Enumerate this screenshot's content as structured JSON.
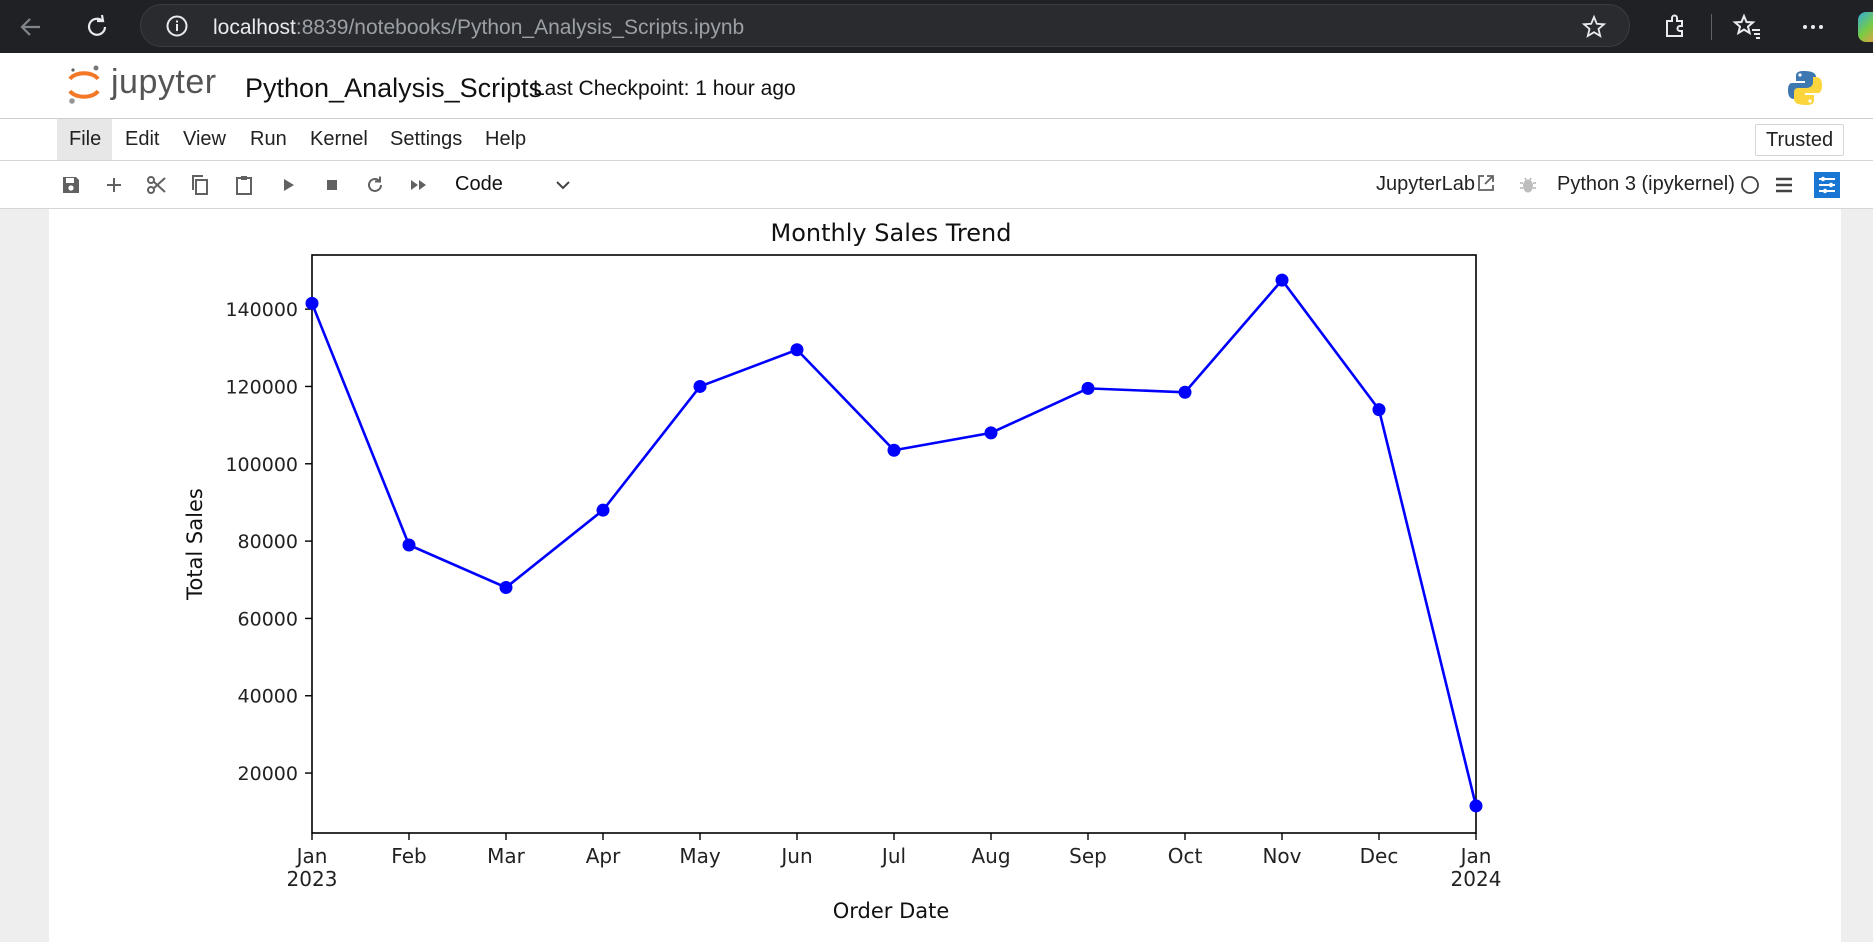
{
  "browser": {
    "url_host": "localhost",
    "url_rest": ":8839/notebooks/Python_Analysis_Scripts.ipynb"
  },
  "header": {
    "logo_text": "jupyter",
    "notebook_name": "Python_Analysis_Scripts",
    "checkpoint": "Last Checkpoint: 1 hour ago"
  },
  "menu": {
    "items": [
      "File",
      "Edit",
      "View",
      "Run",
      "Kernel",
      "Settings",
      "Help"
    ],
    "trusted": "Trusted"
  },
  "toolbar": {
    "cell_type": "Code",
    "jupyterlab": "JupyterLab",
    "kernel": "Python 3 (ipykernel)"
  },
  "colors": {
    "line": "#0000ff",
    "jupyter_orange": "#f37726"
  },
  "chart_data": {
    "type": "line",
    "title": "Monthly Sales Trend",
    "xlabel": "Order Date",
    "ylabel": "Total Sales",
    "x": [
      "2023-01",
      "2023-02",
      "2023-03",
      "2023-04",
      "2023-05",
      "2023-06",
      "2023-07",
      "2023-08",
      "2023-09",
      "2023-10",
      "2023-11",
      "2023-12",
      "2024-01"
    ],
    "x_tick_labels": [
      "Jan",
      "Feb",
      "Mar",
      "Apr",
      "May",
      "Jun",
      "Jul",
      "Aug",
      "Sep",
      "Oct",
      "Nov",
      "Dec",
      "Jan"
    ],
    "x_tick_year_labels": [
      "2023",
      "",
      "",
      "",
      "",
      "",
      "",
      "",
      "",
      "",
      "",
      "",
      "2024"
    ],
    "series": [
      {
        "values": [
          141500,
          79000,
          68000,
          88000,
          120000,
          129500,
          103500,
          108000,
          119500,
          118500,
          147500,
          114000,
          11500
        ]
      }
    ],
    "y_ticks": [
      20000,
      40000,
      60000,
      80000,
      100000,
      120000,
      140000
    ],
    "ylim": [
      4500,
      154000
    ],
    "marker": "circle",
    "grid": false,
    "legend": "none"
  }
}
